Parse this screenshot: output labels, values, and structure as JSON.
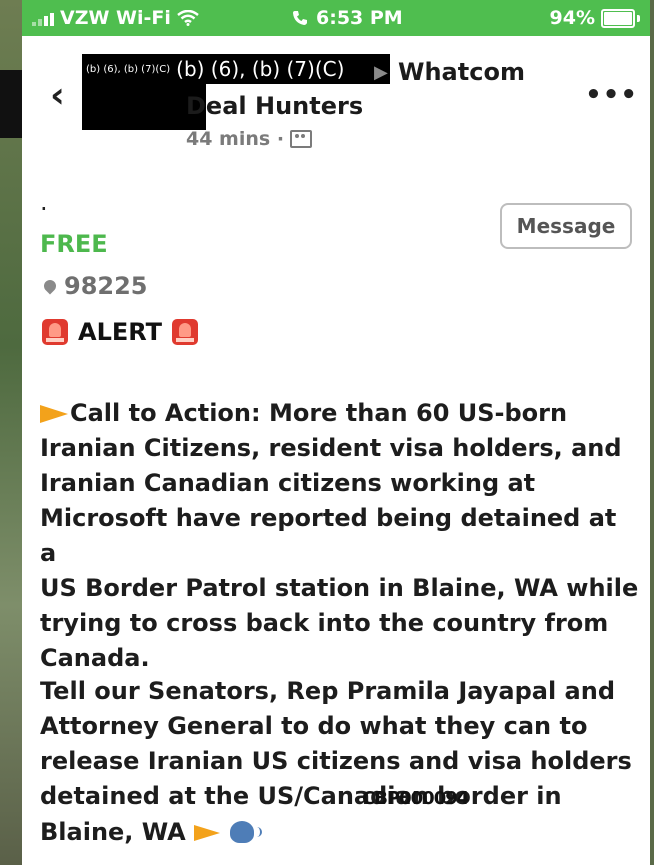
{
  "status_bar": {
    "carrier": "VZW Wi-Fi",
    "time": "6:53 PM",
    "battery": "94%"
  },
  "header": {
    "redaction_small": "(b) (6), (b) (7)(C)",
    "redaction_big": "(b) (6), (b) (7)(C)",
    "group_name_line1": "Whatcom",
    "group_name_line2": "Deal Hunters",
    "time_ago": "44 mins ·"
  },
  "post": {
    "bullet": ".",
    "message_button": "Message",
    "price": "FREE",
    "zip": "98225",
    "alert_label": "ALERT",
    "paragraph1": "Call to Action: More than 60 US-born\nIranian Citizens, resident visa holders, and\nIranian Canadian citizens working at\nMicrosoft have reported being detained at a\nUS Border Patrol station in Blaine, WA while\ntrying to cross back into the country from\nCanada.",
    "paragraph2": "Tell our Senators, Rep Pramila Jayapal and\nAttorney General to do what they can to\nrelease Iranian US citizens and visa holders\ndetained at the US/Canadian border in",
    "last_line": "Blaine, WA",
    "bates_number": "CBP000094"
  },
  "colors": {
    "status_green": "#4fbe4f",
    "price_green": "#4db84d",
    "alert_red": "#e03a2f",
    "megaphone_orange": "#f3a21b"
  },
  "icons": [
    "wifi-icon",
    "phone-icon",
    "battery-icon",
    "back-chevron-icon",
    "group-icon",
    "more-icon",
    "location-pin-icon",
    "siren-icon",
    "megaphone-icon",
    "speaking-head-icon"
  ]
}
